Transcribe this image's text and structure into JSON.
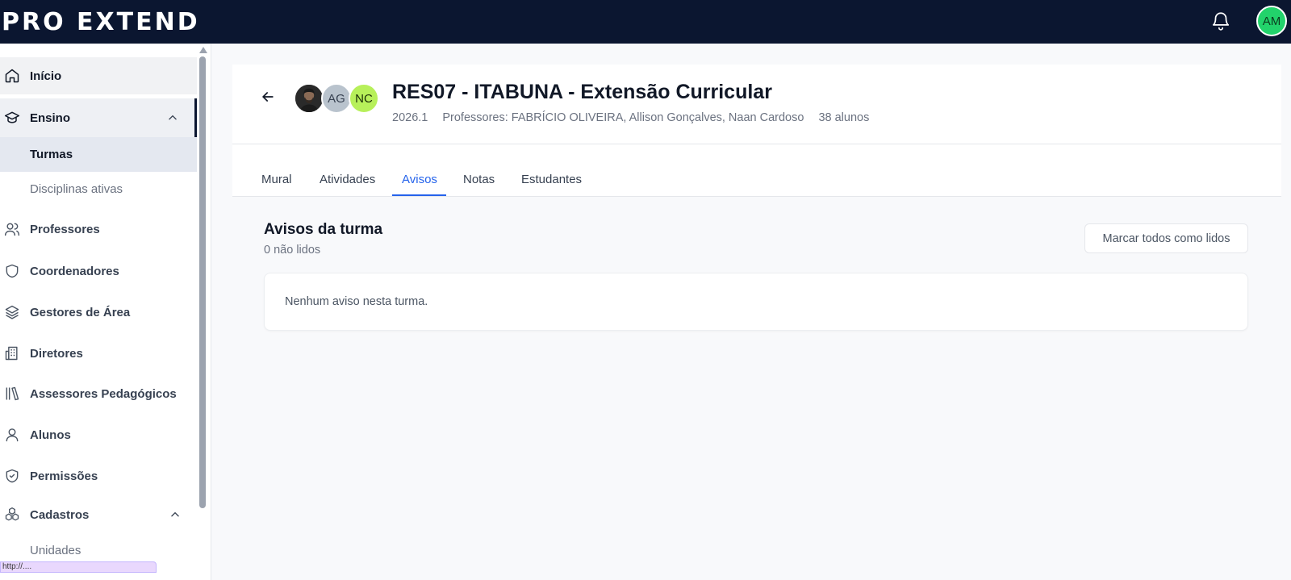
{
  "app": {
    "logo_text": "PRO EXTEND",
    "user_initials": "AM"
  },
  "sidebar": {
    "items": [
      {
        "label": "Início",
        "icon": "home-icon"
      },
      {
        "label": "Ensino",
        "icon": "graduation-cap-icon",
        "expanded": true,
        "children": [
          {
            "label": "Turmas",
            "active": true
          },
          {
            "label": "Disciplinas ativas"
          }
        ]
      },
      {
        "label": "Professores",
        "icon": "users-icon"
      },
      {
        "label": "Coordenadores",
        "icon": "shield-icon"
      },
      {
        "label": "Gestores de Área",
        "icon": "layers-icon"
      },
      {
        "label": "Diretores",
        "icon": "building-icon"
      },
      {
        "label": "Assessores Pedagógicos",
        "icon": "books-icon"
      },
      {
        "label": "Alunos",
        "icon": "user-icon"
      },
      {
        "label": "Permissões",
        "icon": "shield-check-icon"
      },
      {
        "label": "Cadastros",
        "icon": "boxes-icon",
        "expanded": true,
        "children": [
          {
            "label": "Unidades"
          }
        ]
      }
    ],
    "status_url": "http://...."
  },
  "class": {
    "title": "RES07 - ITABUNA - Extensão Curricular",
    "period": "2026.1",
    "teachers": "Professores: FABRÍCIO OLIVEIRA, Allison Gonçalves, Naan Cardoso",
    "students": "38 alunos",
    "avatars": [
      "AG",
      "NC"
    ]
  },
  "tabs": [
    {
      "label": "Mural"
    },
    {
      "label": "Atividades"
    },
    {
      "label": "Avisos",
      "active": true
    },
    {
      "label": "Notas"
    },
    {
      "label": "Estudantes"
    }
  ],
  "notices": {
    "title": "Avisos da turma",
    "unread": "0 não lidos",
    "mark_all_label": "Marcar todos como lidos",
    "empty_message": "Nenhum aviso nesta turma."
  },
  "colors": {
    "topbar": "#0b1630",
    "accent": "#2563eb",
    "user_avatar": "#22d36b",
    "avatar_nc": "#b7f05a",
    "avatar_ag": "#b9c3cd"
  }
}
